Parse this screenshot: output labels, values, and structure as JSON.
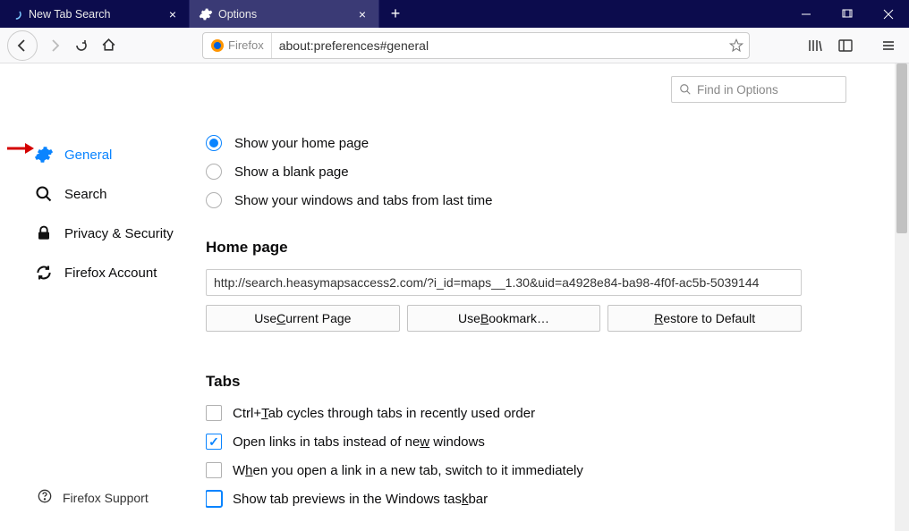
{
  "tabs": [
    {
      "title": "New Tab Search"
    },
    {
      "title": "Options"
    }
  ],
  "urlbar": {
    "identity": "Firefox",
    "url": "about:preferences#general"
  },
  "find_placeholder": "Find in Options",
  "sidebar": {
    "items": [
      {
        "label": "General"
      },
      {
        "label": "Search"
      },
      {
        "label": "Privacy & Security"
      },
      {
        "label": "Firefox Account"
      }
    ],
    "support": "Firefox Support"
  },
  "startup": {
    "radios": [
      {
        "label": "Show your home page",
        "checked": true
      },
      {
        "label": "Show a blank page",
        "checked": false
      },
      {
        "label": "Show your windows and tabs from last time",
        "checked": false
      }
    ]
  },
  "homepage": {
    "heading": "Home page",
    "url": "http://search.heasymapsaccess2.com/?i_id=maps__1.30&uid=a4928e84-ba98-4f0f-ac5b-5039144",
    "buttons": {
      "current": "Use Current Page",
      "bookmark": "Use Bookmark…",
      "restore": "Restore to Default"
    }
  },
  "tabs_section": {
    "heading": "Tabs",
    "items": [
      {
        "text": "Ctrl+Tab cycles through tabs in recently used order",
        "checked": false
      },
      {
        "text": "Open links in tabs instead of new windows",
        "checked": true
      },
      {
        "text": "When you open a link in a new tab, switch to it immediately",
        "checked": false
      },
      {
        "text": "Show tab previews in the Windows taskbar",
        "checked": false
      }
    ]
  }
}
